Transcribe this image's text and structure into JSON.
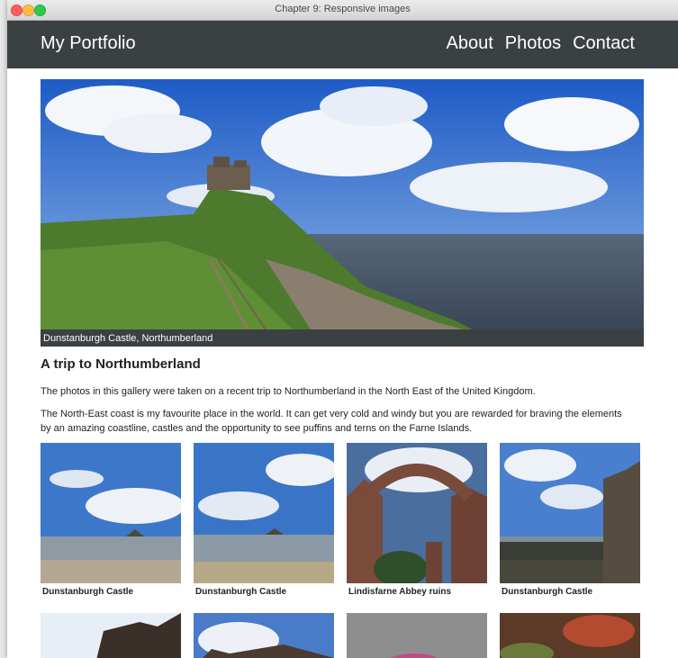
{
  "window": {
    "title": "Chapter 9: Responsive images"
  },
  "header": {
    "brand": "My Portfolio",
    "nav": [
      {
        "label": "About"
      },
      {
        "label": "Photos"
      },
      {
        "label": "Contact"
      }
    ]
  },
  "hero": {
    "caption": "Dunstanburgh Castle, Northumberland"
  },
  "article": {
    "heading": "A trip to Northumberland",
    "paragraphs": [
      "The photos in this gallery were taken on a recent trip to Northumberland in the North East of the United Kingdom.",
      "The North-East coast is my favourite place in the world. It can get very cold and windy but you are rewarded for braving the elements by an amazing coastline, castles and the opportunity to see puffins and terns on the Farne Islands."
    ]
  },
  "gallery": [
    {
      "caption": "Dunstanburgh Castle"
    },
    {
      "caption": "Dunstanburgh Castle"
    },
    {
      "caption": "Lindisfarne Abbey ruins"
    },
    {
      "caption": "Dunstanburgh Castle"
    },
    {
      "caption": ""
    },
    {
      "caption": ""
    },
    {
      "caption": ""
    },
    {
      "caption": ""
    }
  ]
}
